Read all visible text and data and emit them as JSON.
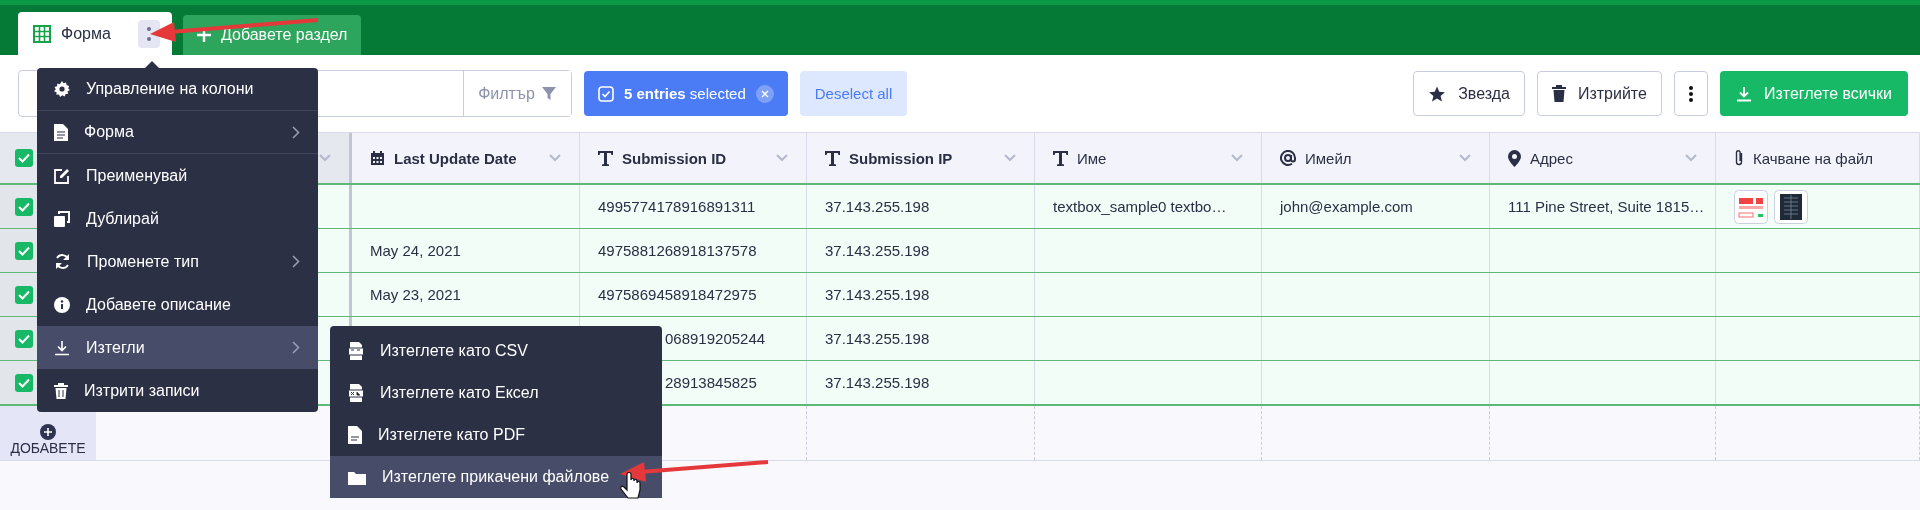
{
  "tabs": [
    {
      "label": "Форма",
      "selected": true,
      "kind": "form"
    },
    {
      "label": "Добавете раздел",
      "selected": false,
      "kind": "add"
    }
  ],
  "toolbar": {
    "filter": "Филтър",
    "selection": "**5 entries** selected",
    "deselect": "Deselect all",
    "actions": [
      {
        "kind": "star",
        "label": "Звезда"
      },
      {
        "kind": "trash",
        "label": "Изтрийте"
      },
      {
        "kind": "more"
      },
      {
        "kind": "download",
        "label": "Изтеглете всички"
      }
    ]
  },
  "table": {
    "all_selected": true,
    "columns": [
      {
        "label": "Last Update Date",
        "kind": "date",
        "system": true,
        "dropdown": true
      },
      {
        "label": "Submission ID",
        "kind": "text",
        "system": true,
        "dropdown": true
      },
      {
        "label": "Submission IP",
        "kind": "text",
        "system": true,
        "dropdown": true
      },
      {
        "label": "Име",
        "kind": "text",
        "system": false,
        "dropdown": true
      },
      {
        "label": "Имейл",
        "kind": "email",
        "system": false,
        "dropdown": true
      },
      {
        "label": "Адрес",
        "kind": "address",
        "system": false,
        "dropdown": true
      },
      {
        "label": "Качване на файл",
        "kind": "file",
        "system": false,
        "dropdown": false
      }
    ],
    "rows": [
      {
        "selected": true,
        "submission_id": "4995774178916891311",
        "submission_ip": "37.143.255.198",
        "name": "textbox_sample0 textbo…",
        "email": "john@example.com",
        "address": "111 Pine Street, Suite 1815…"
      },
      {
        "selected": true,
        "date": "May 24, 2021",
        "submission_id": "4975881268918137578",
        "submission_ip": "37.143.255.198"
      },
      {
        "selected": true,
        "date": "May 23, 2021",
        "submission_id": "4975869458918472975",
        "submission_ip": "37.143.255.198"
      },
      {
        "selected": true,
        "submission_id": "068919205244",
        "id_covered": true,
        "submission_ip": "37.143.255.198"
      },
      {
        "selected": true,
        "submission_id": "28913845825",
        "id_covered": true,
        "submission_ip": "37.143.255.198"
      }
    ],
    "add_label": "ДОБАВЕТЕ"
  },
  "menu": [
    {
      "label": "Управление на колони",
      "kind": "gear",
      "submenu": false,
      "hovered": false
    },
    {
      "label": "Форма",
      "kind": "doc",
      "submenu": true,
      "hovered": false
    },
    {
      "label": "Преименувай",
      "kind": "edit",
      "submenu": false,
      "hovered": false
    },
    {
      "label": "Дублирай",
      "kind": "copy",
      "submenu": false,
      "hovered": false
    },
    {
      "label": "Променете тип",
      "kind": "sync",
      "submenu": true,
      "hovered": false
    },
    {
      "label": "Добавете описание",
      "kind": "info",
      "submenu": false,
      "hovered": false
    },
    {
      "label": "Изтегли",
      "kind": "download",
      "submenu": true,
      "hovered": true
    },
    {
      "label": "Изтрити записи",
      "kind": "trash",
      "submenu": false,
      "hovered": false
    }
  ],
  "submenu": [
    {
      "label": "Изтеглете като CSV",
      "kind": "csv",
      "hovered": false
    },
    {
      "label": "Изтеглете като Ексел",
      "kind": "xls",
      "hovered": false
    },
    {
      "label": "Изтеглете като PDF",
      "kind": "pdf",
      "hovered": false
    },
    {
      "label": "Изтеглете прикачени файлове",
      "kind": "folder",
      "hovered": true
    }
  ]
}
